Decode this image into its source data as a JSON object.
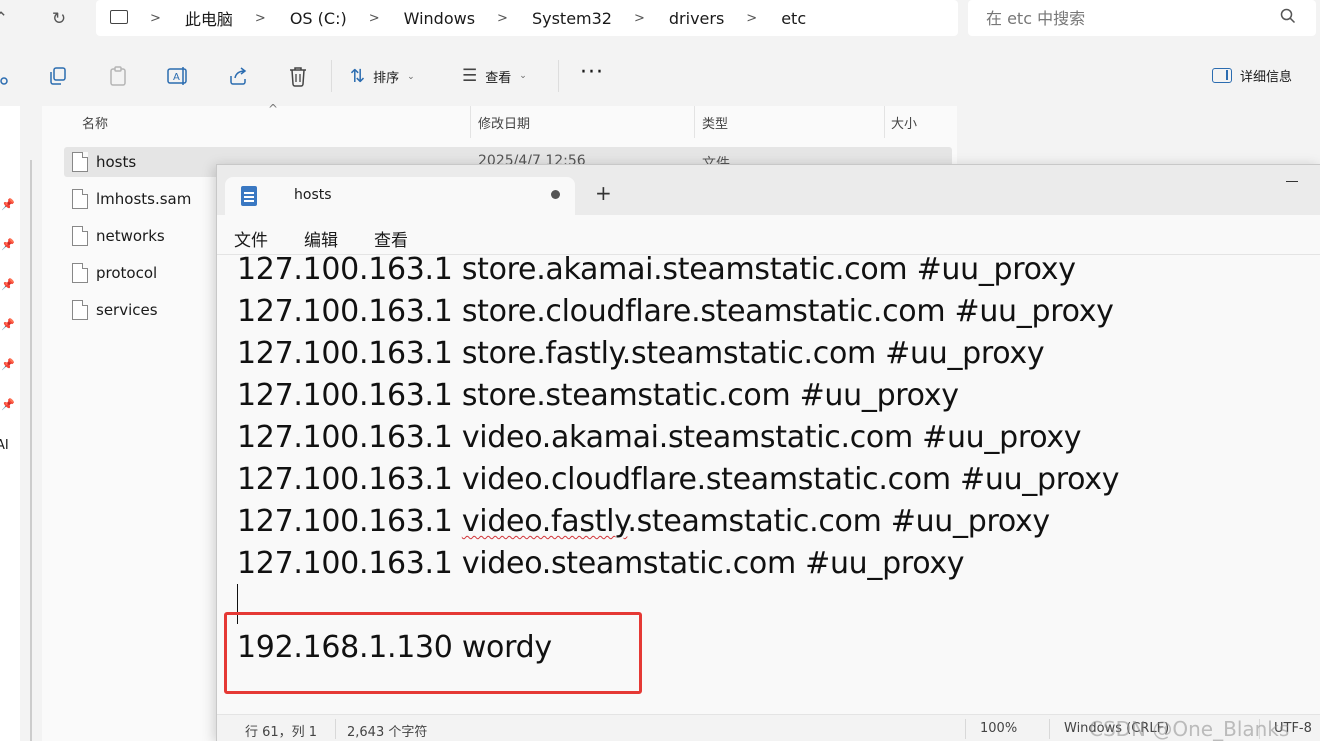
{
  "explorer": {
    "breadcrumb": [
      "此电脑",
      "OS (C:)",
      "Windows",
      "System32",
      "drivers",
      "etc"
    ],
    "search_placeholder": "在 etc 中搜索",
    "toolbar": {
      "sort_label": "排序",
      "view_label": "查看",
      "details_label": "详细信息"
    },
    "columns": [
      "名称",
      "修改日期",
      "类型",
      "大小"
    ],
    "files": [
      {
        "name": "hosts",
        "modified": "2025/4/7 12:56",
        "type": "文件"
      },
      {
        "name": "lmhosts.sam"
      },
      {
        "name": "networks"
      },
      {
        "name": "protocol"
      },
      {
        "name": "services"
      }
    ],
    "sidebar_fragment": "AI"
  },
  "notepad": {
    "tab_title": "hosts",
    "menu": [
      "文件",
      "编辑",
      "查看"
    ],
    "lines": [
      "127.100.163.1 store.akamai.steamstatic.com #uu_proxy",
      "127.100.163.1 store.cloudflare.steamstatic.com #uu_proxy",
      "127.100.163.1 store.fastly.steamstatic.com #uu_proxy",
      "127.100.163.1 store.steamstatic.com #uu_proxy",
      "127.100.163.1 video.akamai.steamstatic.com #uu_proxy",
      "127.100.163.1 video.cloudflare.steamstatic.com #uu_proxy",
      "127.100.163.1 ",
      "127.100.163.1 video.steamstatic.com #uu_proxy",
      "",
      "192.168.1.130 wordy"
    ],
    "line7_underlined": "video.fastly",
    "line7_rest": ".steamstatic.com #uu_proxy",
    "status": {
      "position": "行 61，列 1",
      "chars": "2,643 个字符",
      "zoom": "100%",
      "eol": "Windows (CRLF)",
      "encoding": "UTF-8"
    },
    "watermark": "CSDN @One_Blanks"
  },
  "colors": {
    "highlight": "#e53935",
    "spellcheck": "#d13438",
    "notepad_icon": "#3a78c2"
  }
}
